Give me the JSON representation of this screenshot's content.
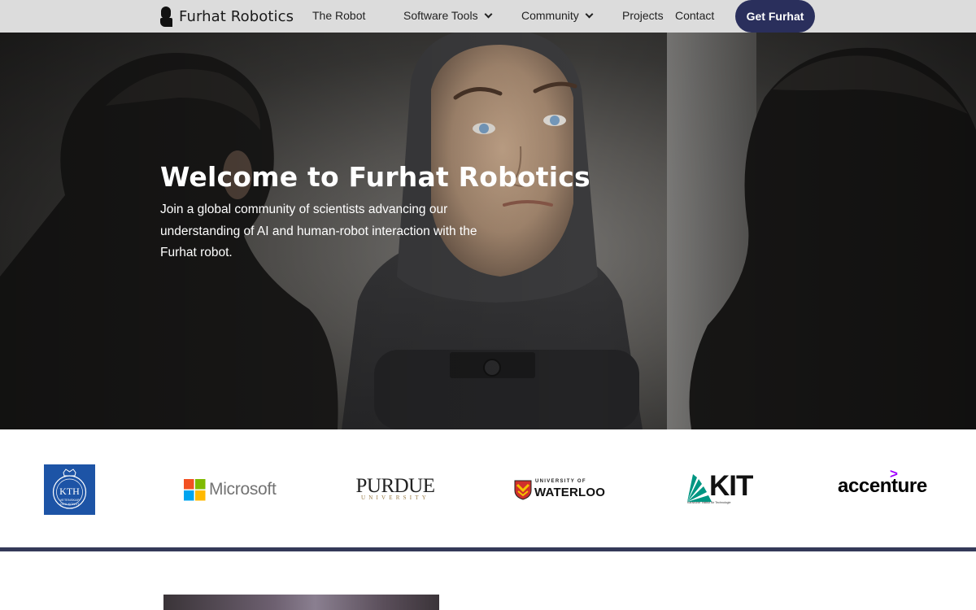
{
  "nav": {
    "brand": "Furhat Robotics",
    "items": [
      {
        "label": "The Robot"
      },
      {
        "label": "Software Tools",
        "has_dropdown": true
      },
      {
        "label": "Community",
        "has_dropdown": true
      },
      {
        "label": "Projects"
      },
      {
        "label": "Contact"
      }
    ],
    "cta": "Get Furhat"
  },
  "hero": {
    "title": "Welcome to Furhat Robotics",
    "subtitle": "Join a global community of scientists advancing our understanding of AI and human-robot interaction with the Furhat robot."
  },
  "partners": {
    "kth": {
      "main": "KTH",
      "small": "VETENSKAP OCH KONST"
    },
    "microsoft": "Microsoft",
    "purdue": {
      "main": "PURDUE",
      "small": "UNIVERSITY"
    },
    "waterloo": {
      "top": "UNIVERSITY OF",
      "main": "WATERLOO"
    },
    "kit": {
      "main": "KIT",
      "small": "Karlsruher Institut für Technologie"
    },
    "accenture": "accenture"
  },
  "colors": {
    "nav_bg": "#dcdcdc",
    "cta_bg": "#2a2f5c",
    "divider": "#343958",
    "hero_text": "#ffffff"
  }
}
